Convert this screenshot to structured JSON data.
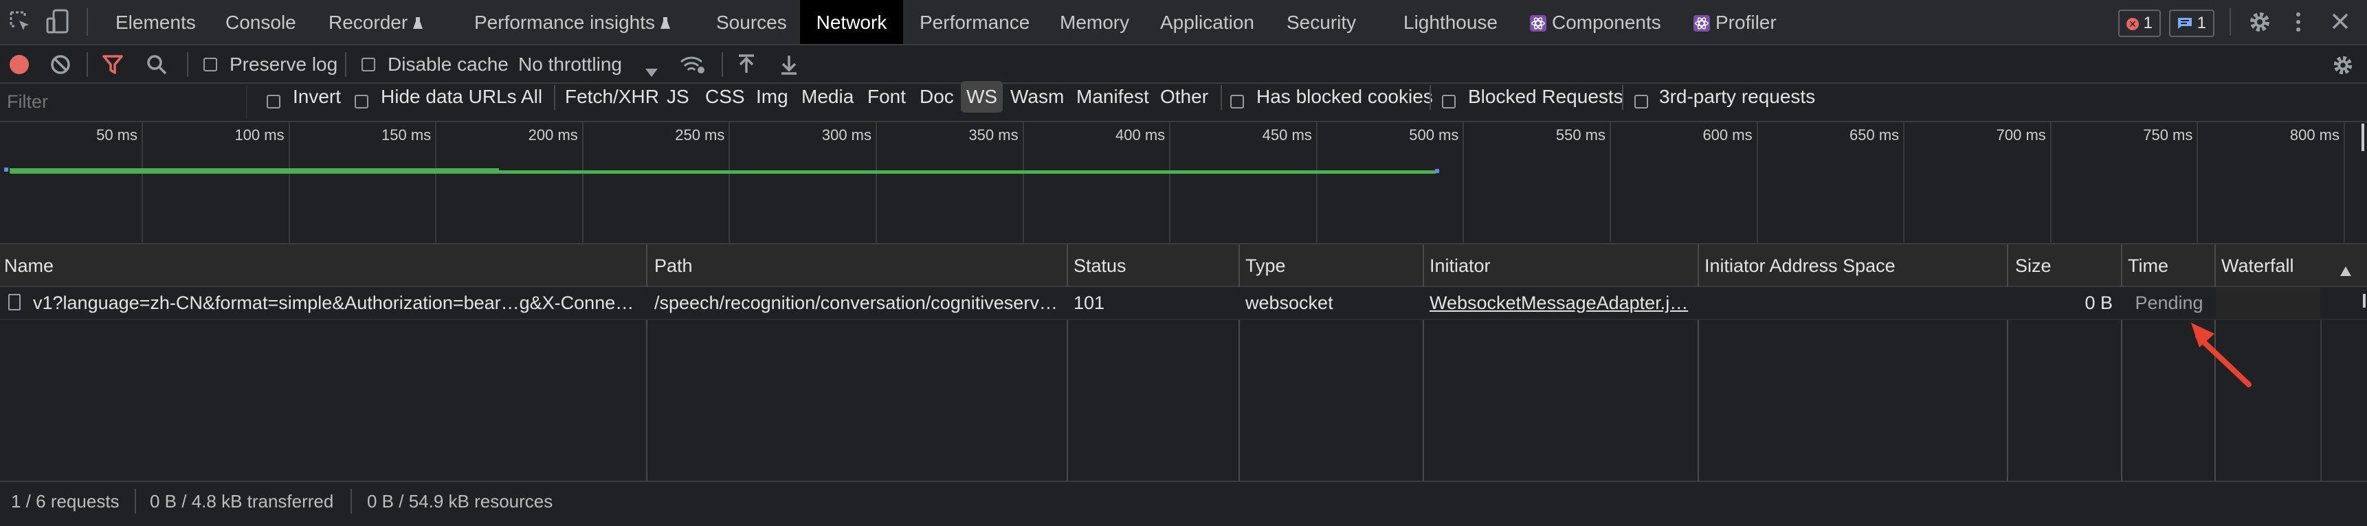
{
  "tabs": [
    {
      "label": "Elements",
      "active": false
    },
    {
      "label": "Console",
      "active": false
    },
    {
      "label": "Recorder",
      "active": false,
      "icon": "flask-icon"
    },
    {
      "label": "Performance insights",
      "active": false,
      "icon": "flask-icon"
    },
    {
      "label": "Sources",
      "active": false
    },
    {
      "label": "Network",
      "active": true
    },
    {
      "label": "Performance",
      "active": false
    },
    {
      "label": "Memory",
      "active": false
    },
    {
      "label": "Application",
      "active": false
    },
    {
      "label": "Security",
      "active": false
    },
    {
      "label": "Lighthouse",
      "active": false
    },
    {
      "label": "Components",
      "active": false,
      "icon": "react-icon"
    },
    {
      "label": "Profiler",
      "active": false,
      "icon": "react-icon"
    }
  ],
  "badges": {
    "errors": "1",
    "messages": "1",
    "error_color": "#e46962",
    "message_color": "#7cacf8"
  },
  "toolbar": {
    "preserve_log": "Preserve log",
    "disable_cache": "Disable cache",
    "throttling": "No throttling"
  },
  "filter": {
    "placeholder": "Filter",
    "invert": "Invert",
    "hide_data_urls": "Hide data URLs",
    "types": [
      "All",
      "Fetch/XHR",
      "JS",
      "CSS",
      "Img",
      "Media",
      "Font",
      "Doc",
      "WS",
      "Wasm",
      "Manifest",
      "Other"
    ],
    "selected_type": "WS",
    "has_blocked_cookies": "Has blocked cookies",
    "blocked_requests": "Blocked Requests",
    "third_party": "3rd-party requests"
  },
  "overview": {
    "ticks": [
      "50 ms",
      "100 ms",
      "150 ms",
      "200 ms",
      "250 ms",
      "300 ms",
      "350 ms",
      "400 ms",
      "450 ms",
      "500 ms",
      "550 ms",
      "600 ms",
      "650 ms",
      "700 ms",
      "750 ms",
      "800 ms"
    ],
    "bar_color": "#4caf50"
  },
  "table": {
    "columns": [
      "Name",
      "Path",
      "Status",
      "Type",
      "Initiator",
      "Initiator Address Space",
      "Size",
      "Time",
      "Waterfall"
    ],
    "rows": [
      {
        "name": "v1?language=zh-CN&format=simple&Authorization=bear…g&X-Connect…",
        "path": "/speech/recognition/conversation/cognitiveserv…",
        "status": "101",
        "type": "websocket",
        "initiator": "WebsocketMessageAdapter.j…",
        "address_space": "",
        "size": "0 B",
        "time": "Pending"
      }
    ]
  },
  "status_bar": {
    "requests": "1 / 6 requests",
    "transferred": "0 B / 4.8 kB transferred",
    "resources": "0 B / 54.9 kB resources"
  },
  "annotation_color": "#e8432e"
}
